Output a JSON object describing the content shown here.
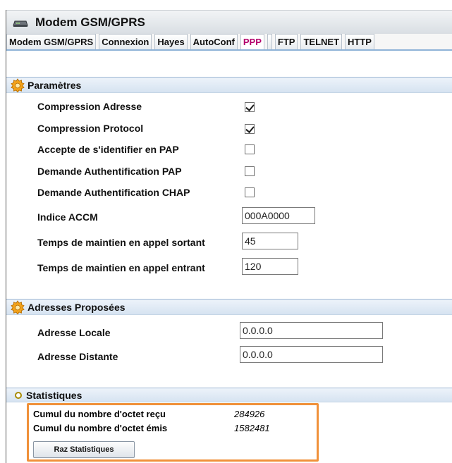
{
  "window": {
    "title": "Modem GSM/GPRS"
  },
  "tabs": [
    {
      "label": "Modem GSM/GPRS",
      "active": false
    },
    {
      "label": "Connexion",
      "active": false
    },
    {
      "label": "Hayes",
      "active": false
    },
    {
      "label": "AutoConf",
      "active": false
    },
    {
      "label": "PPP",
      "active": true
    },
    {
      "label": "",
      "active": false
    },
    {
      "label": "FTP",
      "active": false
    },
    {
      "label": "TELNET",
      "active": false
    },
    {
      "label": "HTTP",
      "active": false
    }
  ],
  "parametres": {
    "header": "Paramètres",
    "compression_adresse": {
      "label": "Compression Adresse",
      "checked": true
    },
    "compression_protocol": {
      "label": "Compression Protocol",
      "checked": true
    },
    "accepte_pap": {
      "label": "Accepte de s'identifier en PAP",
      "checked": false
    },
    "demande_pap": {
      "label": "Demande Authentification PAP",
      "checked": false
    },
    "demande_chap": {
      "label": "Demande Authentification CHAP",
      "checked": false
    },
    "indice_accm": {
      "label": "Indice ACCM",
      "value": "000A0000"
    },
    "temps_sortant": {
      "label": "Temps de maintien en appel sortant",
      "value": "45"
    },
    "temps_entrant": {
      "label": "Temps de maintien en appel entrant",
      "value": "120"
    }
  },
  "adresses": {
    "header": "Adresses Proposées",
    "locale": {
      "label": "Adresse Locale",
      "value": "0.0.0.0"
    },
    "distante": {
      "label": "Adresse Distante",
      "value": "0.0.0.0"
    }
  },
  "statistiques": {
    "header": "Statistiques",
    "recu": {
      "label": "Cumul du nombre d'octet reçu",
      "value": "284926"
    },
    "emis": {
      "label": "Cumul du nombre d'octet émis",
      "value": "1582481"
    },
    "raz_button": "Raz Statistiques"
  },
  "colors": {
    "active_tab": "#b3006b",
    "highlight": "#f0913a",
    "section_header": "#dde8f4"
  }
}
